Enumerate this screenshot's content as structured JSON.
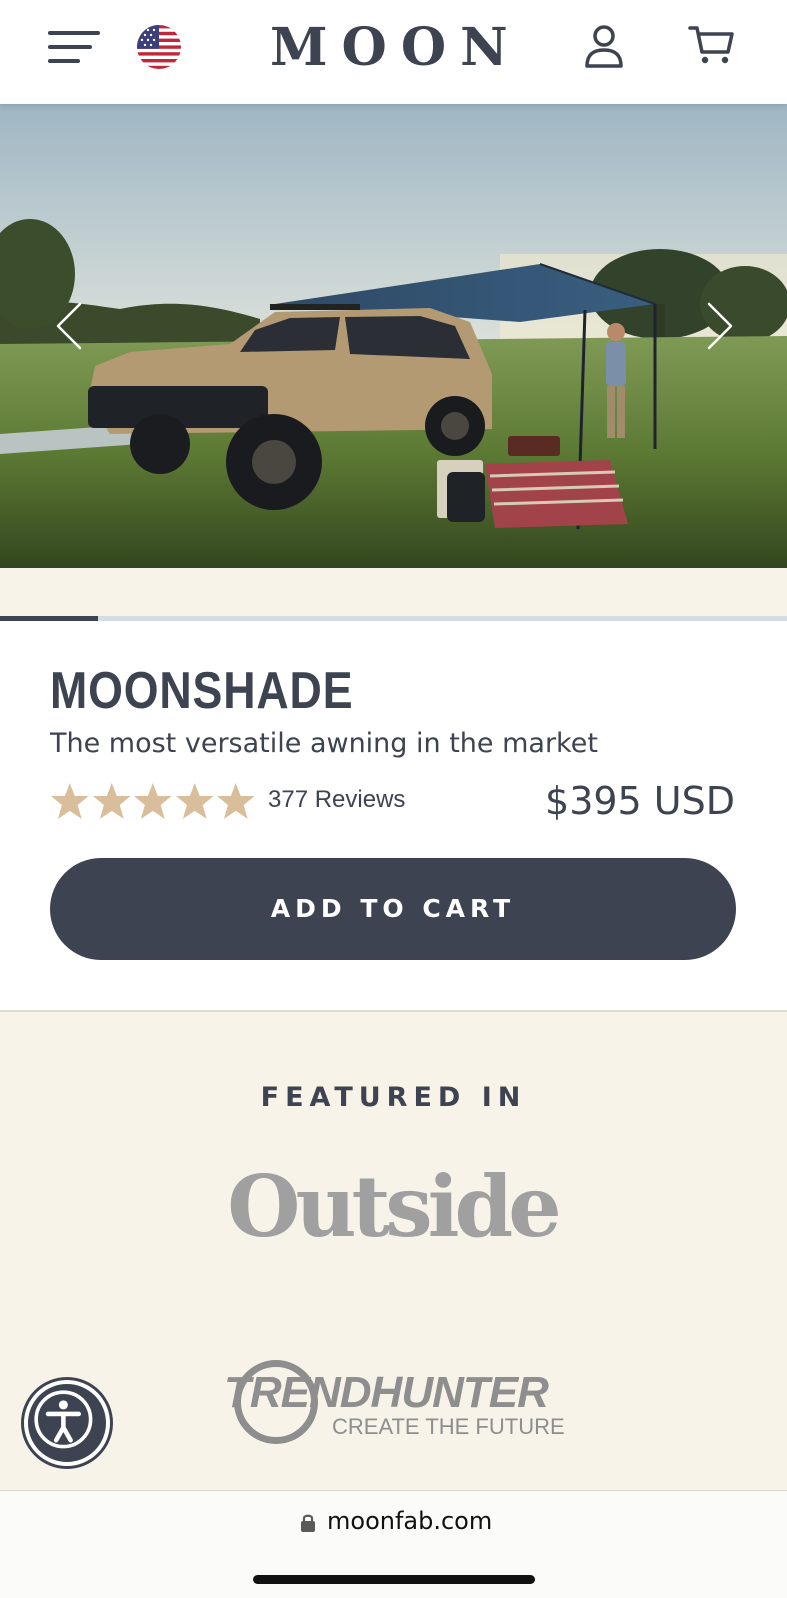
{
  "header": {
    "brand": "MOON",
    "menu_icon": "hamburger-menu-icon",
    "flag_icon": "us-flag-icon",
    "user_icon": "user-account-icon",
    "cart_icon": "shopping-cart-icon"
  },
  "hero": {
    "image_subject": "tan SUV with blue side awning deployed in a grassy field at sunset",
    "carousel_progress": 0.125,
    "prev_icon": "chevron-left-icon",
    "next_icon": "chevron-right-icon"
  },
  "product": {
    "title": "MOONSHADE",
    "subtitle": "The most versatile awning in the market",
    "rating": 5,
    "reviews_label": "377 Reviews",
    "price": "$395 USD",
    "add_to_cart_label": "ADD TO CART"
  },
  "featured": {
    "heading": "FEATURED IN",
    "logos": [
      {
        "name": "Outside",
        "text": "Outside"
      },
      {
        "name": "TrendHunter",
        "text": "TRENDHUNTER",
        "tagline": "CREATE THE FUTURE"
      }
    ]
  },
  "accessibility": {
    "icon": "accessibility-icon"
  },
  "browser": {
    "url": "moonfab.com",
    "lock_icon": "lock-icon"
  },
  "colors": {
    "primary": "#3d4350",
    "star": "#d9be9b",
    "cream_background": "#f7f3e8",
    "logo_gray": "#a0a0a0"
  }
}
